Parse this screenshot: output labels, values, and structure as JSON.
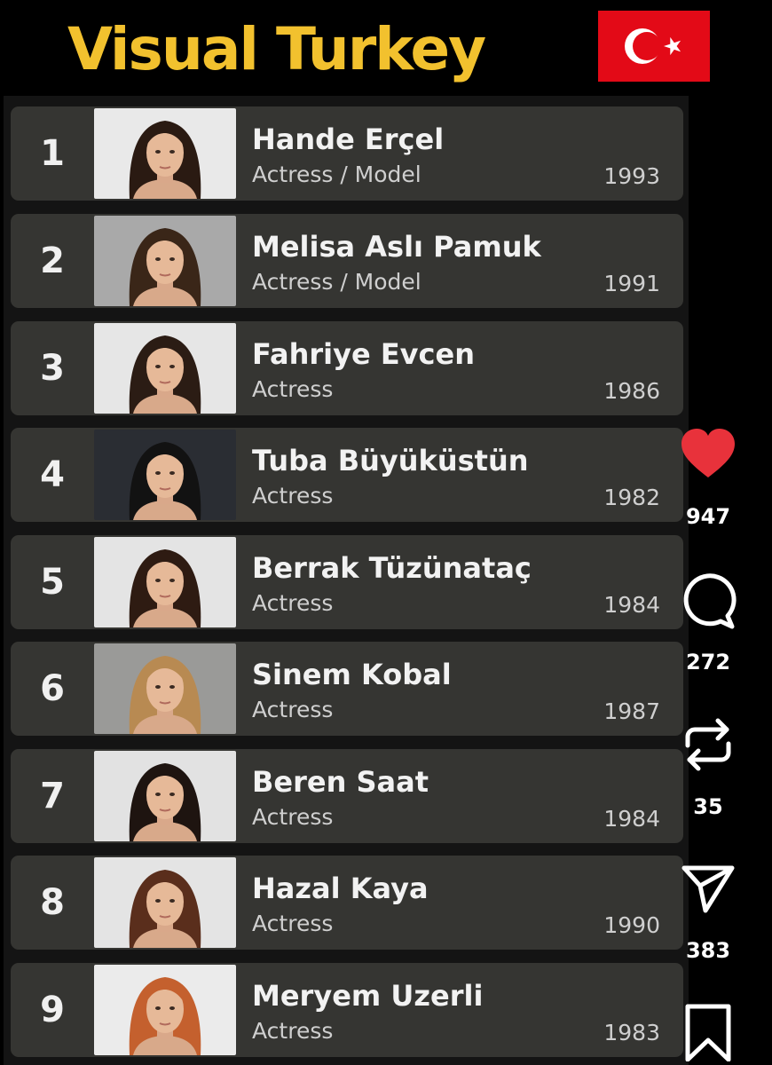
{
  "header": {
    "title": "Visual Turkey",
    "flag_icon": "turkey-flag-icon",
    "flag_color": "#e30a17",
    "title_color": "#f2c12e"
  },
  "list": [
    {
      "rank": "1",
      "name": "Hande Erçel",
      "role": "Actress / Model",
      "year": "1993",
      "hair": "#2a1a12",
      "bg": "#e9e9e9"
    },
    {
      "rank": "2",
      "name": "Melisa Aslı Pamuk",
      "role": "Actress / Model",
      "year": "1991",
      "hair": "#3a2618",
      "bg": "#a9a9a9"
    },
    {
      "rank": "3",
      "name": "Fahriye Evcen",
      "role": "Actress",
      "year": "1986",
      "hair": "#2b1c14",
      "bg": "#e6e6e6"
    },
    {
      "rank": "4",
      "name": "Tuba Büyüküstün",
      "role": "Actress",
      "year": "1982",
      "hair": "#121212",
      "bg": "#2a2d33"
    },
    {
      "rank": "5",
      "name": "Berrak Tüzünataç",
      "role": "Actress",
      "year": "1984",
      "hair": "#2e1b12",
      "bg": "#e4e4e4"
    },
    {
      "rank": "6",
      "name": "Sinem Kobal",
      "role": "Actress",
      "year": "1987",
      "hair": "#b88a52",
      "bg": "#9a9a98"
    },
    {
      "rank": "7",
      "name": "Beren Saat",
      "role": "Actress",
      "year": "1984",
      "hair": "#1e1410",
      "bg": "#e2e2e2"
    },
    {
      "rank": "8",
      "name": "Hazal Kaya",
      "role": "Actress",
      "year": "1990",
      "hair": "#5a2e1c",
      "bg": "#e4e4e4"
    },
    {
      "rank": "9",
      "name": "Meryem Uzerli",
      "role": "Actress",
      "year": "1983",
      "hair": "#c4602e",
      "bg": "#ebebeb"
    }
  ],
  "actions": {
    "likes": "947",
    "comments": "272",
    "reposts": "35",
    "shares": "383",
    "like_color": "#e8323b"
  }
}
